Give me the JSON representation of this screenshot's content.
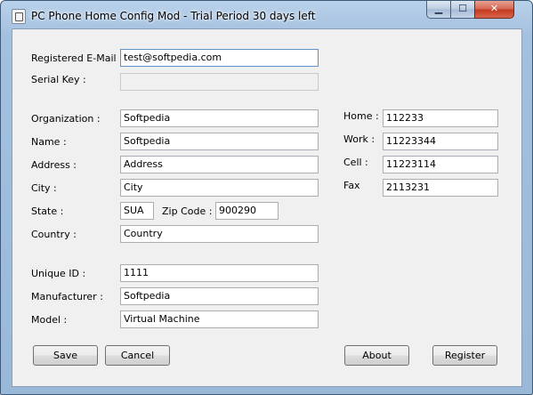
{
  "window": {
    "title": "PC Phone Home Config Mod - Trial Period 30 days left"
  },
  "controls": {
    "minimize": "▁",
    "maximize": "☐",
    "close": "✕"
  },
  "form": {
    "email": {
      "label": "Registered E-Mail :",
      "value": "test@softpedia.com"
    },
    "serial": {
      "label": "Serial Key :",
      "value": ""
    },
    "organization": {
      "label": "Organization :",
      "value": "Softpedia"
    },
    "name": {
      "label": "Name :",
      "value": "Softpedia"
    },
    "address": {
      "label": "Address :",
      "value": "Address"
    },
    "city": {
      "label": "City :",
      "value": "City"
    },
    "state": {
      "label": "State :",
      "value": "SUA"
    },
    "zip": {
      "label": "Zip Code :",
      "value": "900290"
    },
    "country": {
      "label": "Country :",
      "value": "Country"
    },
    "home": {
      "label": "Home :",
      "value": "112233"
    },
    "work": {
      "label": "Work :",
      "value": "11223344"
    },
    "cell": {
      "label": "Cell :",
      "value": "11223114"
    },
    "fax": {
      "label": "Fax",
      "value": "2113231"
    },
    "unique_id": {
      "label": "Unique ID :",
      "value": "1111"
    },
    "manufacturer": {
      "label": "Manufacturer :",
      "value": "Softpedia"
    },
    "model": {
      "label": "Model :",
      "value": "Virtual Machine"
    }
  },
  "buttons": {
    "save": "Save",
    "cancel": "Cancel",
    "about": "About",
    "register": "Register"
  }
}
